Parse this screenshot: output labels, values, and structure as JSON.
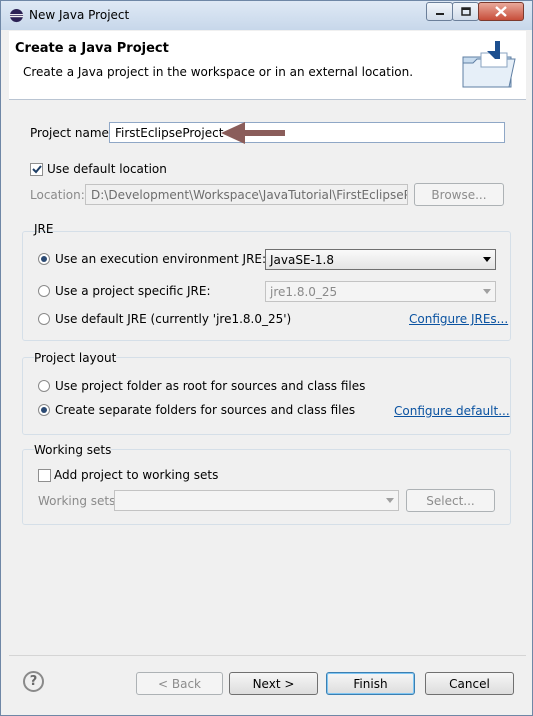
{
  "window": {
    "title": "New Java Project"
  },
  "header": {
    "title": "Create a Java Project",
    "description": "Create a Java project in the workspace or in an external location."
  },
  "project": {
    "name_label": "Project name:",
    "name_value": "FirstEclipseProject"
  },
  "location": {
    "use_default_label": "Use default location",
    "use_default_checked": true,
    "label": "Location:",
    "value": "D:\\Development\\Workspace\\JavaTutorial\\FirstEclipseProjec",
    "browse_label": "Browse..."
  },
  "jre": {
    "group_title": "JRE",
    "options": [
      {
        "label": "Use an execution environment JRE:",
        "selected": true
      },
      {
        "label": "Use a project specific JRE:",
        "selected": false
      },
      {
        "label": "Use default JRE (currently 'jre1.8.0_25')",
        "selected": false
      }
    ],
    "execution_env_value": "JavaSE-1.8",
    "project_specific_value": "jre1.8.0_25",
    "configure_link": "Configure JREs..."
  },
  "layout": {
    "group_title": "Project layout",
    "options": [
      {
        "label": "Use project folder as root for sources and class files",
        "selected": false
      },
      {
        "label": "Create separate folders for sources and class files",
        "selected": true
      }
    ],
    "configure_link": "Configure default..."
  },
  "working_sets": {
    "group_title": "Working sets",
    "add_label": "Add project to working sets",
    "add_checked": false,
    "label": "Working sets:",
    "select_label": "Select..."
  },
  "footer": {
    "help_symbol": "?",
    "back_label": "< Back",
    "next_label": "Next >",
    "finish_label": "Finish",
    "cancel_label": "Cancel"
  },
  "colors": {
    "arrow": "#8a5d5a",
    "link": "#0b53a1",
    "accent": "#2b4a73"
  }
}
